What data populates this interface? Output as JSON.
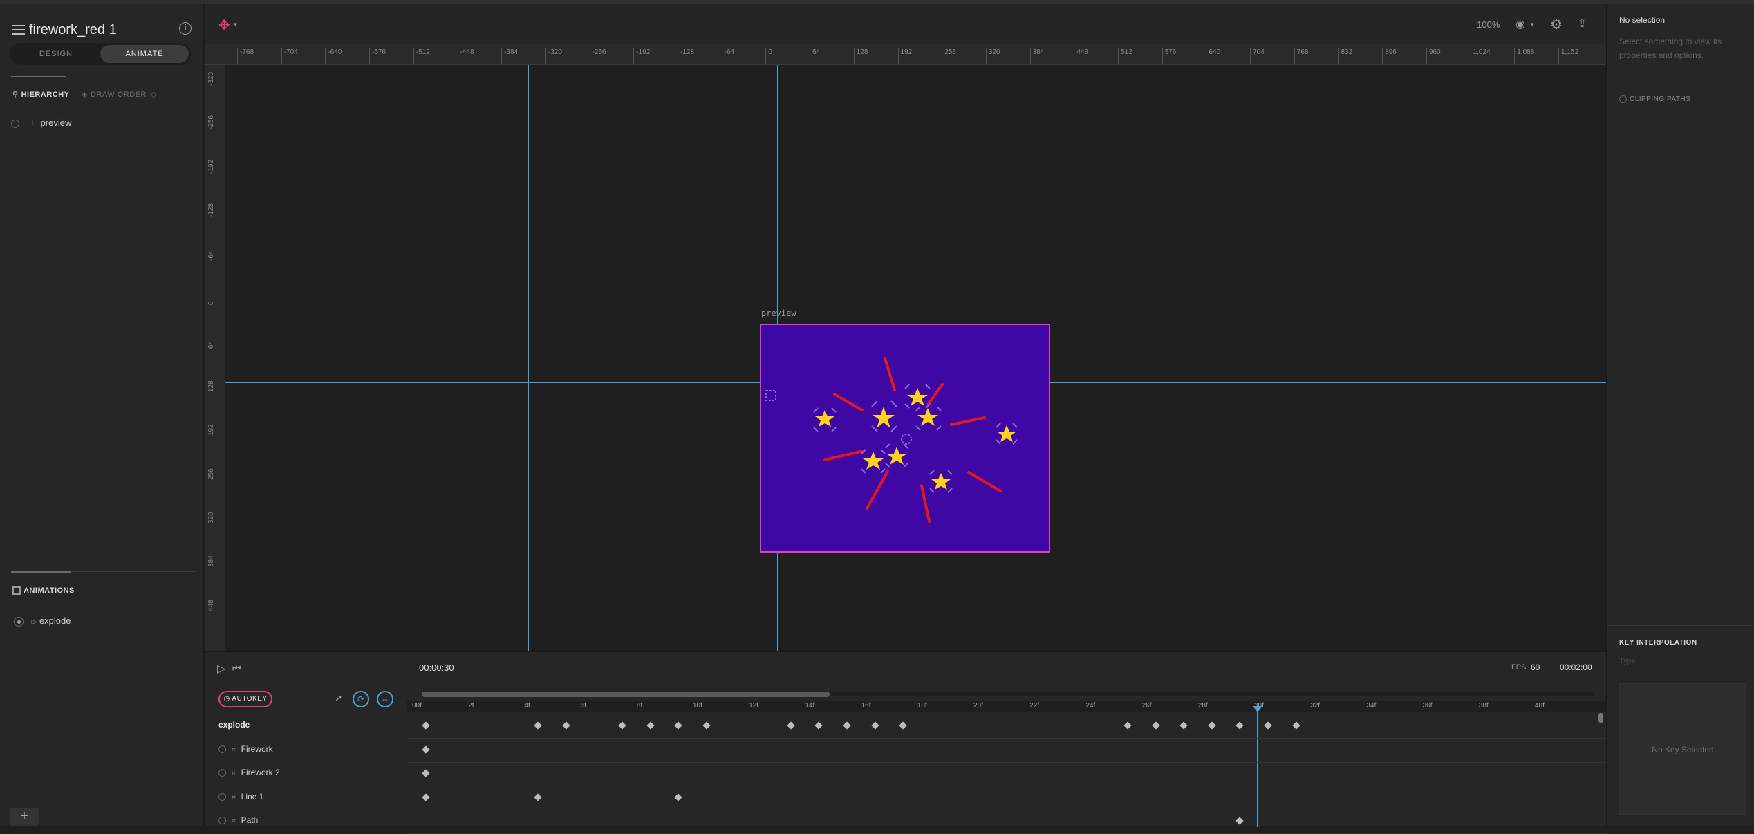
{
  "app": {
    "file_title": "firework_red 1",
    "mode_tabs": [
      "DESIGN",
      "ANIMATE"
    ],
    "active_mode": "ANIMATE"
  },
  "hierarchy": {
    "tab_label": "HIERARCHY",
    "draw_order_label": "DRAW ORDER",
    "items": [
      {
        "label": "preview"
      }
    ]
  },
  "animations": {
    "section_label": "ANIMATIONS",
    "items": [
      {
        "label": "explode"
      }
    ]
  },
  "toolbar": {
    "zoom": "100%"
  },
  "rulers": {
    "horizontal": [
      "-768",
      "-704",
      "-640",
      "-576",
      "-512",
      "-448",
      "-384",
      "-320",
      "-256",
      "-192",
      "-128",
      "-64",
      "0",
      "64",
      "128",
      "192",
      "256",
      "320",
      "384",
      "448",
      "512",
      "576",
      "640",
      "704",
      "768",
      "832",
      "896",
      "960",
      "1,024",
      "1,088",
      "1,152"
    ],
    "vertical": [
      "-320",
      "-256",
      "-192",
      "-128",
      "-64",
      "0",
      "64",
      "128",
      "192",
      "256",
      "320",
      "384",
      "448"
    ]
  },
  "canvas": {
    "artboard_label": "preview",
    "artboard_color": "#3f08a5",
    "artboard_border": "#e040c0",
    "guide_color": "#4aa3d8"
  },
  "inspector": {
    "title": "No selection",
    "hint": "Select something to view its properties and options.",
    "clipping_paths": "CLIPPING PATHS",
    "key_interpolation": "KEY INTERPOLATION",
    "type_placeholder": "Type",
    "no_key": "No Key Selected"
  },
  "timeline": {
    "current_time": "00:00:30",
    "fps_label": "FPS",
    "fps": "60",
    "duration": "00:02:00",
    "autokey": "AUTOKEY",
    "frame_labels": [
      "00f",
      "2f",
      "4f",
      "6f",
      "8f",
      "10f",
      "12f",
      "14f",
      "16f",
      "18f",
      "20f",
      "22f",
      "24f",
      "26f",
      "28f",
      "30f",
      "32f",
      "34f",
      "36f",
      "38f",
      "40f"
    ],
    "tracks": [
      {
        "name": "explode",
        "bold": true,
        "keys": [
          0,
          4,
          5,
          7,
          8,
          9,
          10,
          13,
          14,
          15,
          16,
          17,
          25,
          26,
          27,
          28,
          29,
          30,
          31
        ]
      },
      {
        "name": "Firework",
        "keys": [
          0
        ]
      },
      {
        "name": "Firework 2",
        "keys": [
          0
        ]
      },
      {
        "name": "Line 1",
        "keys": [
          0,
          4,
          9
        ]
      },
      {
        "name": "Path",
        "keys": [
          29
        ]
      }
    ]
  }
}
